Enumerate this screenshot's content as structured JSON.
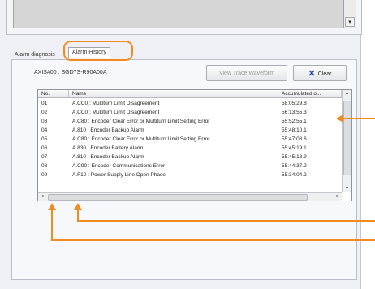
{
  "tabs": [
    {
      "label": "Alarm diagnosis"
    },
    {
      "label": "Alarm History"
    }
  ],
  "axis_label": "AXIS#00 : SGD7S-R90A00A",
  "buttons": {
    "trace": "View Trace Waveform",
    "clear": "Clear"
  },
  "table": {
    "headers": [
      "No.",
      "Name",
      "Accumulated o..."
    ],
    "rows": [
      {
        "no": "01",
        "name": "A.CC0 : Multiturn Limit Disagreement",
        "acc": "58:05:29.8"
      },
      {
        "no": "02",
        "name": "A.CC0 : Multiturn Limit Disagreement",
        "acc": "56:13:55.3"
      },
      {
        "no": "03",
        "name": "A.C80 : Encoder Clear Error or Multiturn Limit Setting Error",
        "acc": "55:52:55.1"
      },
      {
        "no": "04",
        "name": "A.810 : Encoder Backup Alarm",
        "acc": "55:48:10.1"
      },
      {
        "no": "05",
        "name": "A.C80 : Encoder Clear Error or Multiturn Limit Setting Error",
        "acc": "55:47:08.6"
      },
      {
        "no": "06",
        "name": "A.830 : Encoder Battery Alarm",
        "acc": "55:45:19.1"
      },
      {
        "no": "07",
        "name": "A.810 : Encoder Backup Alarm",
        "acc": "55:45:18.9"
      },
      {
        "no": "08",
        "name": "A.C90 : Encoder Communications Error",
        "acc": "55:44:37.2"
      },
      {
        "no": "09",
        "name": "A.F10 : Power Supply Line Open Phase",
        "acc": "55:34:04.2"
      }
    ]
  },
  "colors": {
    "callout": "#f28b1f",
    "clear_icon": "#1c3fc6"
  },
  "icons": [
    "chevron-down-icon",
    "close-x-icon",
    "scroll-up-icon",
    "scroll-down-icon",
    "scroll-left-icon",
    "scroll-right-icon"
  ]
}
